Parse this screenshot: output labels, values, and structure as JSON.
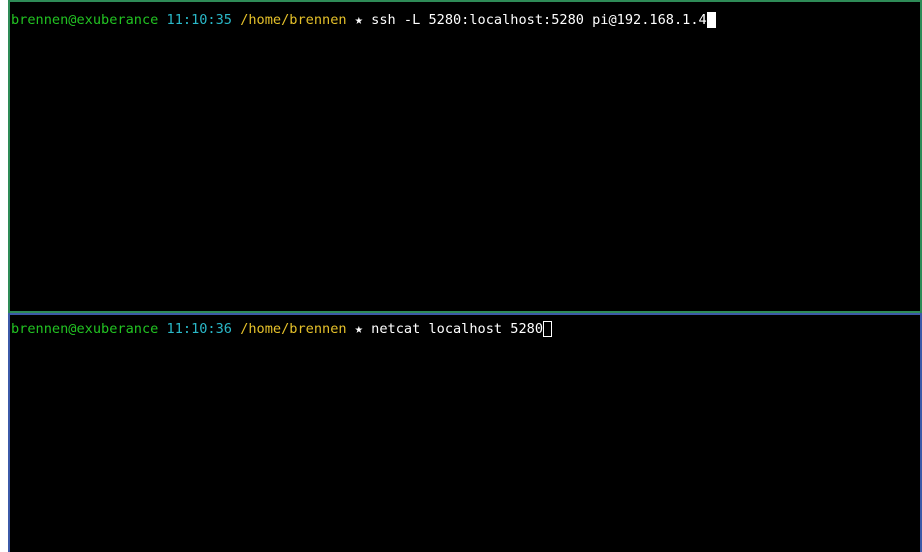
{
  "panes": [
    {
      "prompt": {
        "user_host": "brennen@exuberance",
        "time": "11:10:35",
        "path": "/home/brennen",
        "symbol": "★"
      },
      "command": "ssh -L 5280:localhost:5280 pi@192.168.1.4",
      "cursor": "block"
    },
    {
      "prompt": {
        "user_host": "brennen@exuberance",
        "time": "11:10:36",
        "path": "/home/brennen",
        "symbol": "★"
      },
      "command": "netcat localhost 5280",
      "cursor": "hollow"
    }
  ],
  "colors": {
    "background": "#000000",
    "user_host": "#22c322",
    "time": "#2ab8c8",
    "path": "#e5c12a",
    "text": "#ffffff",
    "top_pane_border": "#2e8b57",
    "bottom_pane_border": "#3c5aa8"
  }
}
